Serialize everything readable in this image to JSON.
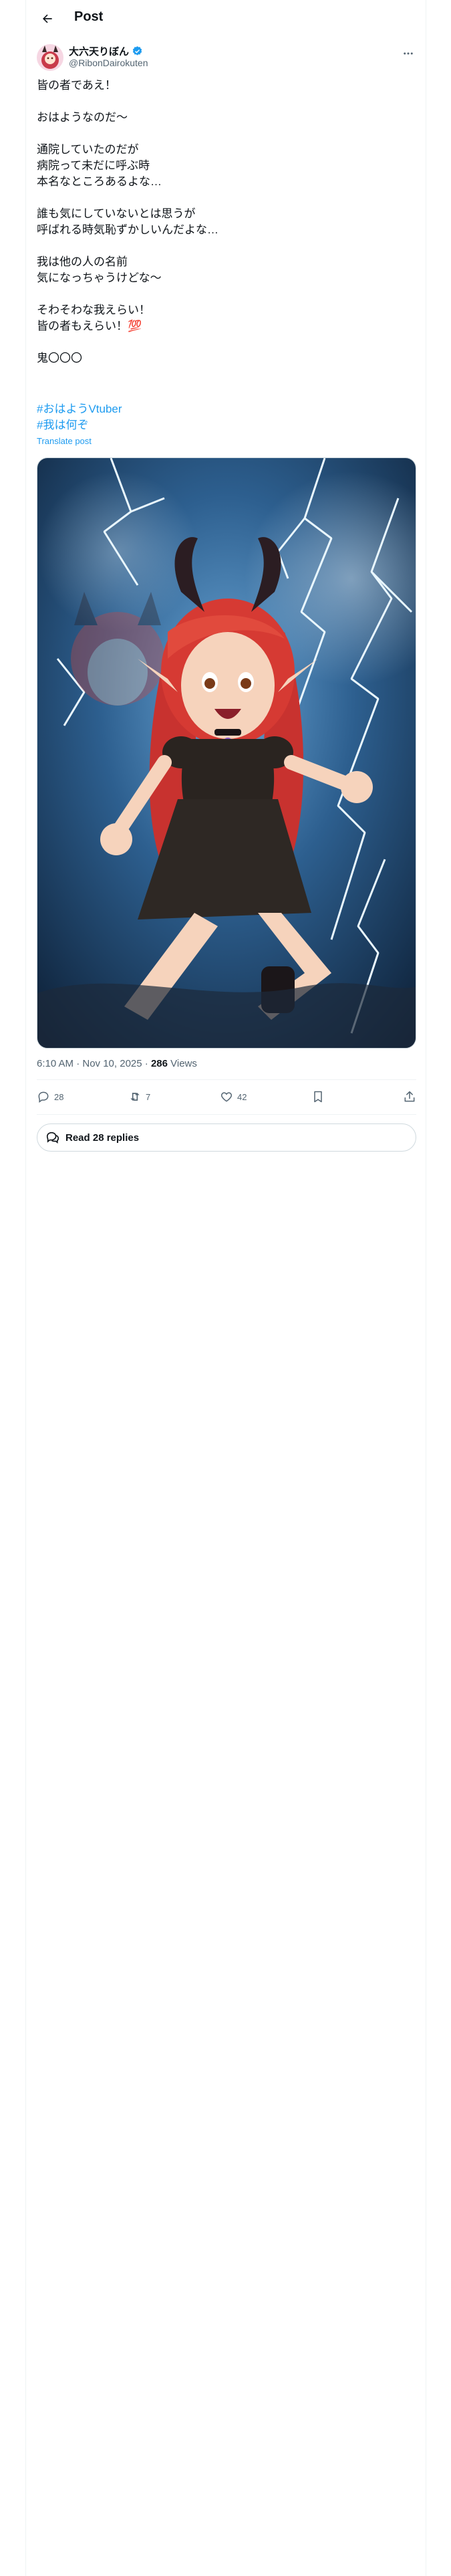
{
  "header": {
    "title": "Post"
  },
  "author": {
    "display_name": "大六天りぼん",
    "handle": "@RibonDairokuten",
    "verified": true
  },
  "post": {
    "text": "皆の者であえ！\n\nおはようなのだ〜\n\n通院していたのだが\n病院って未だに呼ぶ時\n本名なところあるよな…\n\n誰も気にしていないとは思うが\n呼ばれる時気恥ずかしいんだよな…\n\n我は他の人の名前\n気になっちゃうけどな〜\n\nそわそわな我えらい！\n皆の者もえらい！💯\n\n鬼〇〇〇",
    "hashtags": [
      "#おはようVtuber",
      "#我は何ぞ"
    ],
    "translate_label": "Translate post",
    "timestamp": "6:10 AM · Nov 10, 2025 · ",
    "views_count": "286",
    "views_label": " Views"
  },
  "actions": {
    "replies": "28",
    "reposts": "7",
    "likes": "42"
  },
  "read_replies_label": "Read 28 replies",
  "colors": {
    "accent": "#1d9bf0",
    "text": "#0f1419",
    "muted": "#536471",
    "border": "#cfd9de"
  }
}
